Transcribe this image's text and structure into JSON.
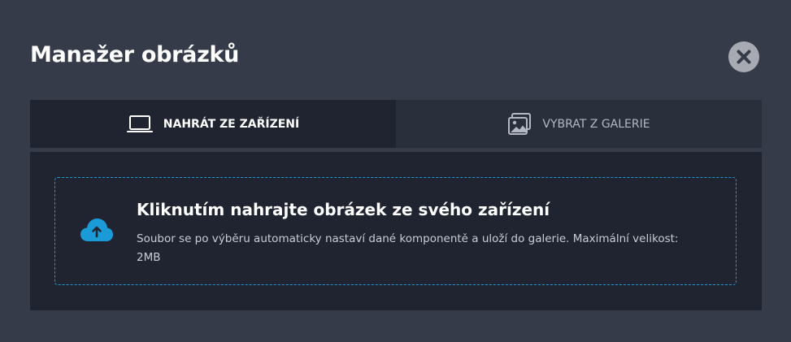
{
  "modal": {
    "title": "Manažer obrázků",
    "close_icon": "close-icon"
  },
  "tabs": [
    {
      "label": "NAHRÁT ZE ZAŘÍZENÍ",
      "icon": "laptop-icon",
      "active": true
    },
    {
      "label": "VYBRAT Z GALERIE",
      "icon": "gallery-icon",
      "active": false
    }
  ],
  "upload": {
    "icon": "cloud-upload-icon",
    "heading": "Kliknutím nahrajte obrázek ze svého zařízení",
    "description": "Soubor se po výběru automaticky nastaví dané komponentě a uloží do galerie. Maximální velikost: 2MB"
  },
  "colors": {
    "background": "#363b4a",
    "panel": "#1f2430",
    "accent": "#1a9ad6",
    "close_button": "#a7aab3"
  }
}
